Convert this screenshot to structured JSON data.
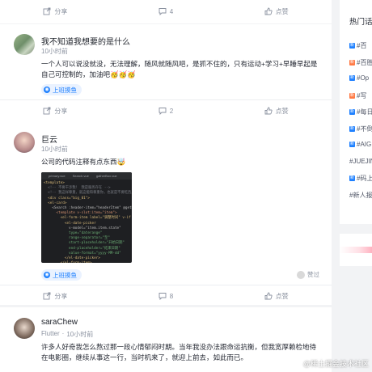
{
  "post0": {
    "share": "分享",
    "comments": "4",
    "like": "点赞"
  },
  "post1": {
    "author": "我不知道我想要的是什么",
    "time": "10小时前",
    "content": "一个人可以说没就没，无法理解，随风就随风吧，是抓不住的，只有运动+学习+早睡早起是自己可控制的，加油吧🥳🥳🥳",
    "tag": "上班摸鱼",
    "share": "分享",
    "comments": "2",
    "like": "点赞"
  },
  "post2": {
    "author": "巨云",
    "time": "10小时前",
    "content": "公司的代码注释有点东西🤯",
    "tag": "上班摸鱼",
    "reply_tip": "赞过",
    "share": "分享",
    "comments": "8",
    "like": "点赞",
    "code_tabs": [
      "primary.vue",
      "Search.vue",
      "gatherBox.vue"
    ],
    "code_lines": [
      {
        "t": "<template>",
        "c": "tg"
      },
      {
        "t": "  <!-- 不要干涉我！ 我是服务存在 -->",
        "c": "cm"
      },
      {
        "t": "  <!-- 我这样尊重，就这能和尊重你，也就是不要吃西瓜 -->",
        "c": "cm"
      },
      {
        "t": "  <div class=\"big_01\">",
        "c": "tg"
      },
      {
        "t": "  <el-card>",
        "c": "tg"
      },
      {
        "t": "    <Search :header-item=\"headerItem\" @getData",
        "c": "at"
      },
      {
        "t": "      <template v-slot:item=\"item\">",
        "c": "kw"
      },
      {
        "t": "        <el-form-item label=\"调整时间\" v-if",
        "c": "tg"
      },
      {
        "t": "          <el-date-picker",
        "c": "tg"
      },
      {
        "t": "            v-model=\"item.item.state\"",
        "c": "at"
      },
      {
        "t": "            type=\"daterange\"",
        "c": "st"
      },
      {
        "t": "            range-separator=\"至\"",
        "c": "st"
      },
      {
        "t": "            start-placeholder=\"开始日期\"",
        "c": "st"
      },
      {
        "t": "            end-placeholder=\"结束日期\"",
        "c": "st"
      },
      {
        "t": "            value-format=\"yyyy-MM-dd\"",
        "c": "st"
      },
      {
        "t": "          </el-date-picker>",
        "c": "tg"
      },
      {
        "t": "        </el-form-item>",
        "c": "tg"
      }
    ]
  },
  "post3": {
    "author": "saraChew",
    "role": "Flutter",
    "time": "10小时前",
    "content": "许多人好奇我怎么熬过那一段心情郁闷时期。当年我没办法跟命运抗衡，但我宽厚赖检地待在电影圈，继续从事这一行，当时机来了，就迎上前去，如此而已。"
  },
  "sidebar": {
    "title": "热门话题",
    "items": [
      {
        "text": "#百",
        "badge": "new",
        "color": "#1e80ff"
      },
      {
        "text": "#百胜",
        "badge": "hot",
        "color": "#ff7a45"
      },
      {
        "text": "#Op",
        "badge": "new",
        "color": "#1e80ff"
      },
      {
        "text": "#写",
        "badge": "new",
        "color": "#ff7a45"
      },
      {
        "text": "#每日",
        "badge": "new",
        "color": "#1e80ff"
      },
      {
        "text": "#不倒",
        "badge": "new",
        "color": "#1e80ff"
      },
      {
        "text": "#AIG",
        "badge": "new",
        "color": "#1e80ff"
      },
      {
        "text": "#JUEJIN",
        "badge": "",
        "color": ""
      },
      {
        "text": "#码上",
        "badge": "new",
        "color": "#1e80ff"
      },
      {
        "text": "#新人报",
        "badge": "",
        "color": ""
      }
    ]
  },
  "watermark": "@稀土掘金技术社区",
  "colors": {
    "accent": "#1e80ff",
    "bg": "#f2f3f5"
  }
}
